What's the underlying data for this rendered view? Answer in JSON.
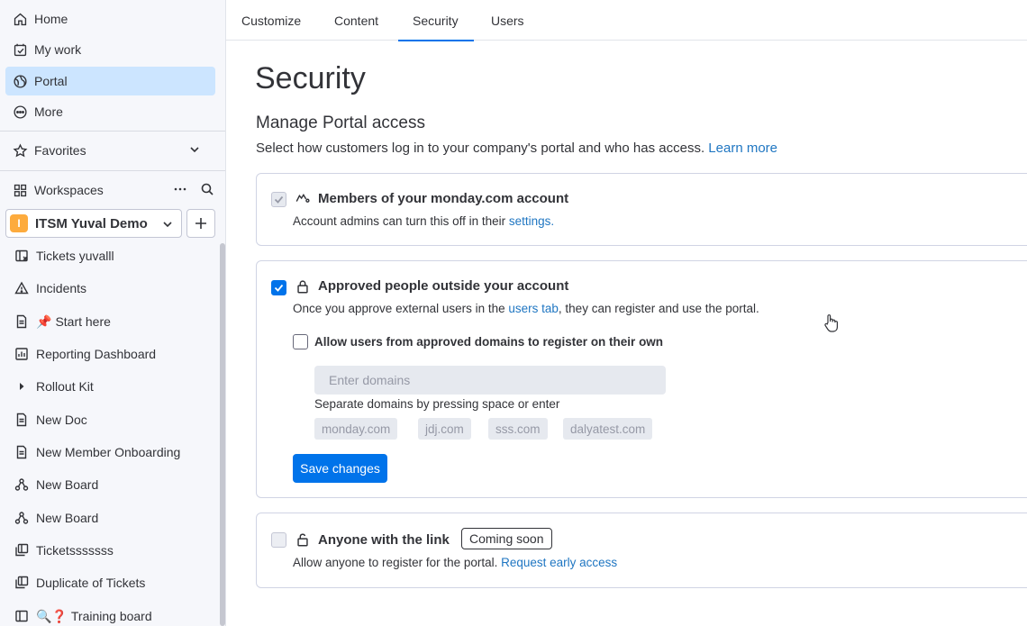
{
  "sidebar": {
    "nav": [
      {
        "label": "Home",
        "icon": "home-icon"
      },
      {
        "label": "My work",
        "icon": "calendar-check-icon"
      },
      {
        "label": "Portal",
        "icon": "globe-icon"
      },
      {
        "label": "More",
        "icon": "more-icon"
      }
    ],
    "favorites_label": "Favorites",
    "workspaces_label": "Workspaces",
    "workspace": {
      "badge": "I",
      "name": "ITSM Yuval Demo"
    },
    "boards": [
      {
        "label": "Tickets yuvalll",
        "icon": "board-icon"
      },
      {
        "label": "Incidents",
        "icon": "warning-icon"
      },
      {
        "label": "Start here",
        "icon": "doc-icon",
        "emoji": "📌"
      },
      {
        "label": "Reporting Dashboard",
        "icon": "dashboard-icon"
      },
      {
        "label": "Rollout Kit",
        "icon": "caret-right-icon"
      },
      {
        "label": "New Doc",
        "icon": "doc-icon"
      },
      {
        "label": "New Member Onboarding",
        "icon": "doc-icon"
      },
      {
        "label": "New Board",
        "icon": "workflow-icon"
      },
      {
        "label": "New Board",
        "icon": "workflow-icon"
      },
      {
        "label": "Ticketsssssss",
        "icon": "board-copy-icon"
      },
      {
        "label": "Duplicate of Tickets",
        "icon": "board-copy-icon"
      },
      {
        "label": "Training board",
        "icon": "panel-icon",
        "emoji": "🔍❓"
      }
    ]
  },
  "tabs": [
    {
      "label": "Customize"
    },
    {
      "label": "Content"
    },
    {
      "label": "Security"
    },
    {
      "label": "Users"
    }
  ],
  "active_tab": "Security",
  "main": {
    "title": "Security",
    "section_title": "Manage Portal access",
    "section_desc": "Select how customers log in to your company's portal and who has access.",
    "learn_more": "Learn more",
    "options": [
      {
        "title": "Members of your monday.com account",
        "desc_prefix": "Account admins can turn this off in their ",
        "desc_link": "settings.",
        "desc_suffix": "",
        "checked": true,
        "disabled": true
      },
      {
        "title": "Approved people outside your account",
        "desc_prefix": "Once you approve external users in the ",
        "desc_link": "users tab",
        "desc_suffix": ", they can register and use the portal.",
        "checked": true,
        "disabled": false,
        "sub": {
          "label": "Allow users from approved domains to register on their own",
          "checked": false,
          "input_placeholder": "Enter domains",
          "hint": "Separate domains by pressing space or enter",
          "domains": [
            "monday.com",
            "jdj.com",
            "sss.com",
            "dalyatest.com"
          ],
          "save_label": "Save changes"
        }
      },
      {
        "title": "Anyone with the link",
        "badge": "Coming soon",
        "desc_prefix": "Allow anyone to register for the portal. ",
        "desc_link": "Request early access",
        "desc_suffix": "",
        "checked": false,
        "disabled": true
      }
    ]
  },
  "colors": {
    "accent": "#0073ea",
    "link": "#1f76c2",
    "active_nav": "#cce5ff",
    "workspace_badge": "#fdab3d"
  }
}
